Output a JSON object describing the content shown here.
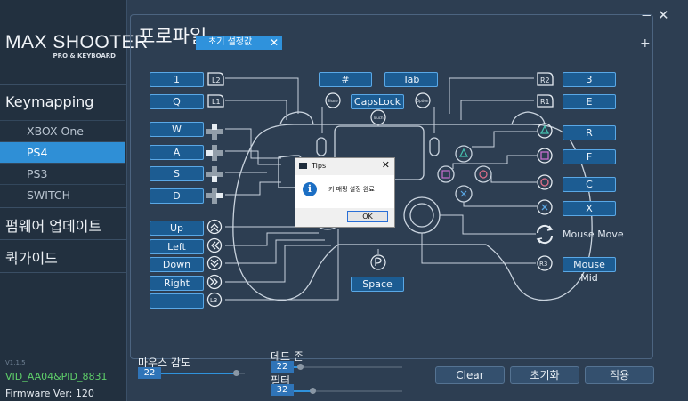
{
  "window": {
    "minimize": "−",
    "close": "✕"
  },
  "logo": {
    "text_a": "MAX",
    "text_b": " SHOOTER",
    "sub": "PRO & KEYBOARD"
  },
  "sidebar": {
    "keymapping": "Keymapping",
    "items": [
      {
        "label": "XBOX One",
        "active": false
      },
      {
        "label": "PS4",
        "active": true
      },
      {
        "label": "PS3",
        "active": false
      },
      {
        "label": "SWITCH",
        "active": false
      }
    ],
    "firmware_update": "펌웨어 업데이트",
    "quick_guide": "퀵가이드",
    "version": "V1.1.5",
    "vid": "VID_AA04&PID_8831",
    "firmware": "Firmware Ver:   120"
  },
  "profile": {
    "title": "프로파일",
    "tab_label": "초기 설정값",
    "tab_close": "✕",
    "add": "+"
  },
  "mapping": {
    "L2": "1",
    "L1": "Q",
    "dpad_up": "W",
    "dpad_left": "A",
    "dpad_down": "S",
    "dpad_right": "D",
    "ls_up": "Up",
    "ls_left": "Left",
    "ls_down": "Down",
    "ls_right": "Right",
    "L3": "",
    "share": "#",
    "touchpad": "CapsLock",
    "options": "Tab",
    "ps": "Space",
    "R2": "3",
    "R1": "E",
    "triangle": "R",
    "square": "F",
    "circle": "C",
    "cross": "X",
    "R3": "Mouse Mid"
  },
  "labels": {
    "L2": "L2",
    "L1": "L1",
    "L3": "L3",
    "R2": "R2",
    "R1": "R1",
    "R3": "R3",
    "share": "Share",
    "touch": "Touch",
    "options": "Option",
    "mouse_move": "Mouse Move"
  },
  "sliders": {
    "mouse_sensitivity": {
      "label": "마우스 감도",
      "value": "22",
      "level": 0.92
    },
    "dead_zone": {
      "label": "데드 존",
      "value": "22",
      "level": 0.22
    },
    "filter": {
      "label": "필터",
      "value": "32",
      "level": 0.32
    }
  },
  "buttons": {
    "clear": "Clear",
    "reset": "초기화",
    "apply": "적용"
  },
  "dialog": {
    "title": "Tips",
    "close": "✕",
    "icon": "i",
    "message": "키 매핑 설정 완료",
    "ok": "OK"
  },
  "colors": {
    "accent": "#2f92dc",
    "background": "#2d3e52",
    "sidebar": "#22303f",
    "vid_text": "#5fd06a"
  }
}
